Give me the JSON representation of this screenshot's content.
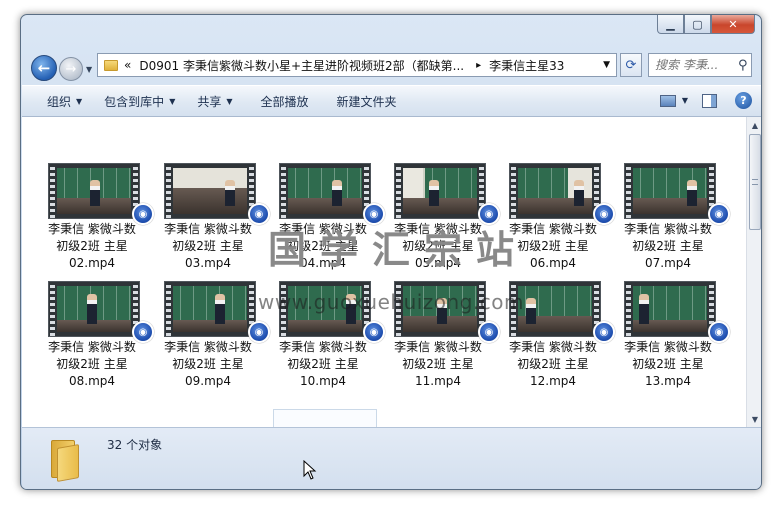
{
  "window": {
    "caption_buttons": {
      "minimize": "▁",
      "maximize": "▢",
      "close": "✕"
    }
  },
  "nav": {
    "back_icon": "back-arrow-icon",
    "forward_icon": "forward-arrow-icon",
    "address": {
      "overflow": "«",
      "segment1": "D0901 李秉信紫微斗数小星+主星进阶视频班2部（都缺第...",
      "separator": "▸",
      "segment2": "李秉信主星33"
    },
    "search_placeholder": "搜索 李秉..."
  },
  "toolbar": {
    "items": [
      "组织",
      "包含到库中",
      "共享",
      "全部播放",
      "新建文件夹"
    ],
    "help": "?"
  },
  "files": [
    {
      "line1": "李秉信 紫微斗数",
      "line2": "初级2班 主星",
      "line3": "02.mp4"
    },
    {
      "line1": "李秉信 紫微斗数",
      "line2": "初级2班 主星",
      "line3": "03.mp4"
    },
    {
      "line1": "李秉信 紫微斗数",
      "line2": "初级2班 主星",
      "line3": "04.mp4"
    },
    {
      "line1": "李秉信 紫微斗数",
      "line2": "初级2班 主星",
      "line3": "05.mp4"
    },
    {
      "line1": "李秉信 紫微斗数",
      "line2": "初级2班 主星",
      "line3": "06.mp4"
    },
    {
      "line1": "李秉信 紫微斗数",
      "line2": "初级2班 主星",
      "line3": "07.mp4"
    },
    {
      "line1": "李秉信 紫微斗数",
      "line2": "初级2班 主星",
      "line3": "08.mp4"
    },
    {
      "line1": "李秉信 紫微斗数",
      "line2": "初级2班 主星",
      "line3": "09.mp4"
    },
    {
      "line1": "李秉信 紫微斗数",
      "line2": "初级2班 主星",
      "line3": "10.mp4"
    },
    {
      "line1": "李秉信 紫微斗数",
      "line2": "初级2班 主星",
      "line3": "11.mp4"
    },
    {
      "line1": "李秉信 紫微斗数",
      "line2": "初级2班 主星",
      "line3": "12.mp4"
    },
    {
      "line1": "李秉信 紫微斗数",
      "line2": "初级2班 主星",
      "line3": "13.mp4"
    }
  ],
  "watermark": {
    "text": "国学汇宗站",
    "url": "www.guoxuehuizong.com"
  },
  "status": {
    "count_text": "32 个对象"
  },
  "colors": {
    "window_frame": "#c5d6ea",
    "toolbar": "#dfe8f3",
    "player_badge": "#1f4fb0",
    "folder": "#e9bc4a"
  }
}
